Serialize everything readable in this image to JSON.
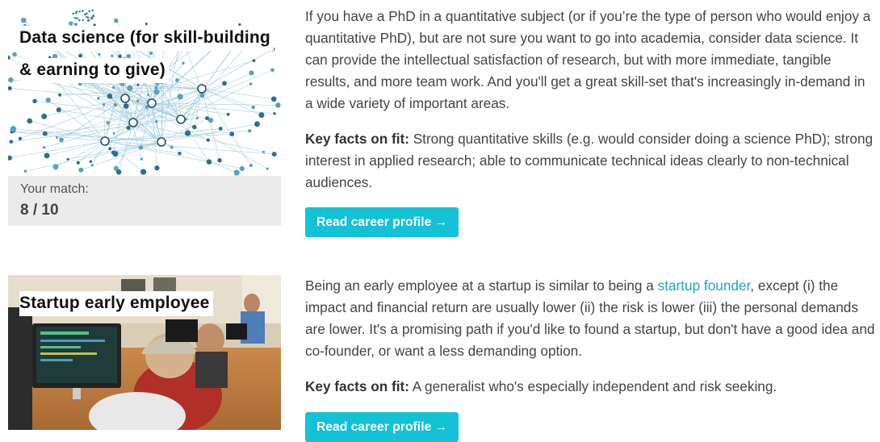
{
  "careers": [
    {
      "title_lines": [
        "Data science (for skill-building",
        "& earning to give)"
      ],
      "image_icon": "network-graph-image",
      "match_label": "Your match:",
      "match_score": "8 / 10",
      "description": "If you have a PhD in a quantitative subject (or if you’re the type of person who would enjoy a quantitative PhD), but are not sure you want to go into academia, consider data science. It can provide the intellectual satisfaction of research, but with more immediate, tangible results, and more team work. And you'll get a great skill-set that's increasingly in-demand in a wide variety of important areas.",
      "fit_label": "Key facts on fit:",
      "fit_text": " Strong quantitative skills (e.g. would consider doing a science PhD); strong interest in applied research; able to communicate technical ideas clearly to non-technical audiences.",
      "button_label": "Read career profile →"
    },
    {
      "title_lines": [
        "Startup early employee"
      ],
      "image_icon": "office-photo-image",
      "desc_before_link": "Being an early employee at a startup is similar to being a ",
      "desc_link": "startup founder",
      "desc_after_link": ", except (i) the impact and financial return are usually lower (ii) the risk is lower (iii) the personal demands are lower. It's a promising path if you'd like to found a startup, but don't have a good idea and co-founder, or want a less demanding option.",
      "fit_label": "Key facts on fit:",
      "fit_text": " A generalist who's especially independent and risk seeking.",
      "button_label": "Read career profile →"
    }
  ],
  "colors": {
    "accent": "#14c2d6",
    "link": "#1aa7c7",
    "match_bg": "#ebebeb"
  }
}
